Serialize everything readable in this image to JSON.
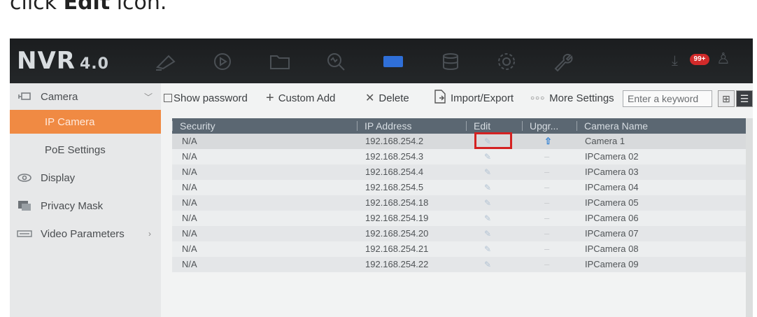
{
  "caption": {
    "prefix": "click ",
    "bold": "Edit",
    "suffix": " icon."
  },
  "topbar": {
    "logo_main": "NVR",
    "logo_version": "4.0",
    "icons": [
      "live-view-icon",
      "playback-icon",
      "folder-icon",
      "search-vca-icon",
      "camera-active-icon",
      "storage-icon",
      "settings-icon",
      "maintenance-icon"
    ],
    "badge": "99+"
  },
  "sidebar": {
    "items": [
      {
        "label": "Camera",
        "icon": "camera-icon"
      },
      {
        "label": "IP Camera"
      },
      {
        "label": "PoE Settings"
      },
      {
        "label": "Display",
        "icon": "eye-icon"
      },
      {
        "label": "Privacy Mask",
        "icon": "mask-icon"
      },
      {
        "label": "Video Parameters",
        "icon": "video-params-icon"
      }
    ]
  },
  "toolbar": {
    "show_password": "Show password",
    "custom_add": "Custom Add",
    "delete": "Delete",
    "import_export": "Import/Export",
    "more_settings": "More Settings",
    "search_placeholder": "Enter a keyword"
  },
  "table": {
    "headers": {
      "security": "Security",
      "ip": "IP Address",
      "edit": "Edit",
      "upgrade": "Upgr...",
      "name": "Camera Name"
    },
    "rows": [
      {
        "security": "N/A",
        "ip": "192.168.254.2",
        "upgrade": "⇧",
        "name": "Camera 1"
      },
      {
        "security": "N/A",
        "ip": "192.168.254.3",
        "upgrade": "–",
        "name": "IPCamera 02"
      },
      {
        "security": "N/A",
        "ip": "192.168.254.4",
        "upgrade": "–",
        "name": "IPCamera 03"
      },
      {
        "security": "N/A",
        "ip": "192.168.254.5",
        "upgrade": "–",
        "name": "IPCamera 04"
      },
      {
        "security": "N/A",
        "ip": "192.168.254.18",
        "upgrade": "–",
        "name": "IPCamera 05"
      },
      {
        "security": "N/A",
        "ip": "192.168.254.19",
        "upgrade": "–",
        "name": "IPCamera 06"
      },
      {
        "security": "N/A",
        "ip": "192.168.254.20",
        "upgrade": "–",
        "name": "IPCamera 07"
      },
      {
        "security": "N/A",
        "ip": "192.168.254.21",
        "upgrade": "–",
        "name": "IPCamera 08"
      },
      {
        "security": "N/A",
        "ip": "192.168.254.22",
        "upgrade": "–",
        "name": "IPCamera 09"
      }
    ]
  },
  "colors": {
    "accent_orange": "#f08a43",
    "highlight_red": "#d42222",
    "header_bg": "#5b6772",
    "active_icon_blue": "#2f6fd8"
  }
}
